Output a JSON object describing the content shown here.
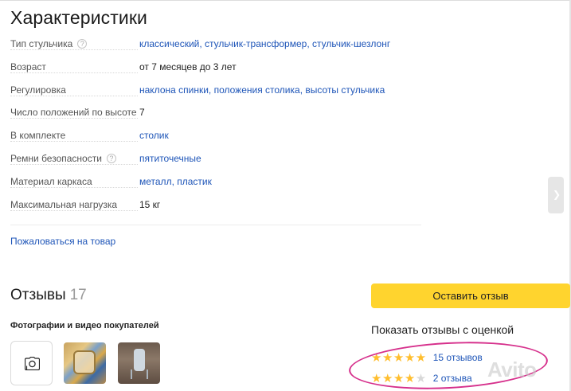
{
  "section_title": "Характеристики",
  "specs": [
    {
      "label": "Тип стульчика",
      "help": true,
      "value": "классический, стульчик-трансформер, стульчик-шезлонг",
      "link": true
    },
    {
      "label": "Возраст",
      "help": false,
      "value": "от 7 месяцев до 3 лет",
      "link": false
    },
    {
      "label": "Регулировка",
      "help": false,
      "value": "наклона спинки, положения столика, высоты стульчика",
      "link": true
    },
    {
      "label": "Число положений по высоте",
      "help": false,
      "value": "7",
      "link": false
    },
    {
      "label": "В комплекте",
      "help": false,
      "value": "столик",
      "link": true
    },
    {
      "label": "Ремни безопасности",
      "help": true,
      "value": "пятиточечные",
      "link": true
    },
    {
      "label": "Материал каркаса",
      "help": false,
      "value": "металл, пластик",
      "link": true
    },
    {
      "label": "Максимальная нагрузка",
      "help": false,
      "value": "15 кг",
      "link": false
    }
  ],
  "complain_link": "Пожаловаться на товар",
  "reviews": {
    "title": "Отзывы",
    "count": "17",
    "photos_label": "Фотографии и видео покупателей",
    "leave_button": "Оставить отзыв",
    "show_label": "Показать отзывы с оценкой",
    "ratings": [
      {
        "stars": 5,
        "count_text": "15 отзывов"
      },
      {
        "stars": 4,
        "count_text": "2 отзыва"
      }
    ]
  },
  "watermark": "Avito",
  "colors": {
    "link": "#1e55b8",
    "accent": "#ffd42e",
    "star": "#ffbe2e",
    "highlight": "#d6308c"
  }
}
